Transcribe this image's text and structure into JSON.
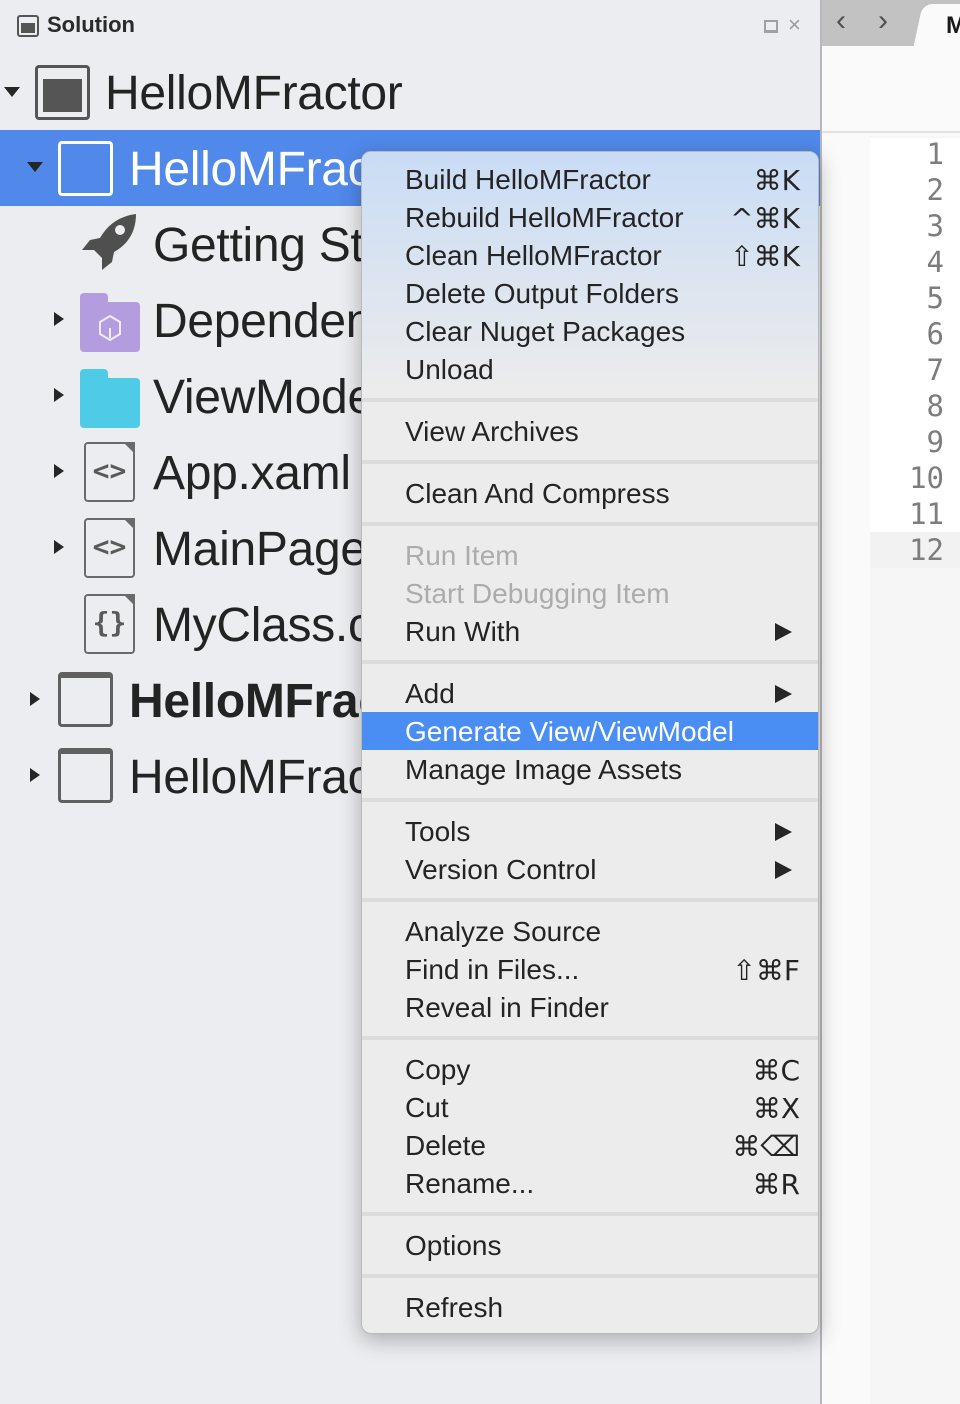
{
  "pad": {
    "title": "Solution",
    "title_icon": "solution-pad-icon",
    "controls": {
      "maximize_icon": "maximize-icon",
      "close_icon": "close-icon",
      "close_glyph": "×"
    }
  },
  "tree": [
    {
      "label": "HelloMFractor",
      "icon": "solution-icon",
      "expanded": true,
      "level": 0,
      "bold": false,
      "selected": false
    },
    {
      "label": "HelloMFractor",
      "icon": "project-icon",
      "expanded": true,
      "level": 1,
      "bold": false,
      "selected": true
    },
    {
      "label": "Getting Started",
      "icon": "rocket-icon",
      "level": 2,
      "bold": false,
      "selected": false
    },
    {
      "label": "Dependencies",
      "icon": "dependencies-folder-icon",
      "expanded": false,
      "level": 2,
      "bold": false,
      "selected": false
    },
    {
      "label": "ViewModels",
      "icon": "folder-icon",
      "expanded": false,
      "level": 2,
      "bold": false,
      "selected": false
    },
    {
      "label": "App.xaml",
      "icon": "xaml-file-icon",
      "expanded": false,
      "level": 2,
      "bold": false,
      "selected": false
    },
    {
      "label": "MainPage.xaml",
      "icon": "xaml-file-icon",
      "expanded": false,
      "level": 2,
      "bold": false,
      "selected": false
    },
    {
      "label": "MyClass.cs",
      "icon": "csharp-file-icon",
      "level": 2,
      "bold": false,
      "selected": false
    },
    {
      "label": "HelloMFractor",
      "icon": "project-icon",
      "expanded": false,
      "level": 1,
      "bold": true,
      "selected": false
    },
    {
      "label": "HelloMFractor",
      "icon": "project-icon",
      "expanded": false,
      "level": 1,
      "bold": false,
      "selected": false
    }
  ],
  "tree_icons": {
    "xaml_glyph": "<>",
    "cs_glyph": "{}",
    "rocket_glyph": "🚀"
  },
  "editor": {
    "back_glyph": "‹",
    "forward_glyph": "›",
    "tab_label": "M",
    "line_numbers": [
      "1",
      "2",
      "3",
      "4",
      "5",
      "6",
      "7",
      "8",
      "9",
      "10",
      "11",
      "12"
    ],
    "current_line": "12"
  },
  "context_menu": {
    "items": [
      {
        "label": "Build HelloMFractor",
        "shortcut": "⌘K"
      },
      {
        "label": "Rebuild HelloMFractor",
        "shortcut": "^⌘K"
      },
      {
        "label": "Clean HelloMFractor",
        "shortcut": "⇧⌘K"
      },
      {
        "label": "Delete Output Folders"
      },
      {
        "label": "Clear Nuget Packages"
      },
      {
        "label": "Unload"
      },
      {
        "separator": true
      },
      {
        "label": "View Archives"
      },
      {
        "separator": true
      },
      {
        "label": "Clean And Compress"
      },
      {
        "separator": true
      },
      {
        "label": "Run Item",
        "disabled": true
      },
      {
        "label": "Start Debugging Item",
        "disabled": true
      },
      {
        "label": "Run With",
        "submenu": true
      },
      {
        "separator": true
      },
      {
        "label": "Add",
        "submenu": true
      },
      {
        "label": "Generate View/ViewModel",
        "highlighted": true
      },
      {
        "label": "Manage Image Assets"
      },
      {
        "separator": true
      },
      {
        "label": "Tools",
        "submenu": true
      },
      {
        "label": "Version Control",
        "submenu": true
      },
      {
        "separator": true
      },
      {
        "label": "Analyze Source"
      },
      {
        "label": "Find in Files...",
        "shortcut": "⇧⌘F"
      },
      {
        "label": "Reveal in Finder"
      },
      {
        "separator": true
      },
      {
        "label": "Copy",
        "shortcut": "⌘C"
      },
      {
        "label": "Cut",
        "shortcut": "⌘X"
      },
      {
        "label": "Delete",
        "shortcut": "⌘⌫"
      },
      {
        "label": "Rename...",
        "shortcut": "⌘R"
      },
      {
        "separator": true
      },
      {
        "label": "Options"
      },
      {
        "separator": true
      },
      {
        "label": "Refresh"
      }
    ]
  },
  "colors": {
    "selection": "#5089ea",
    "menu_highlight": "#4a8ef4",
    "dependencies_folder": "#b39ddf",
    "folder": "#4ecbe6"
  }
}
